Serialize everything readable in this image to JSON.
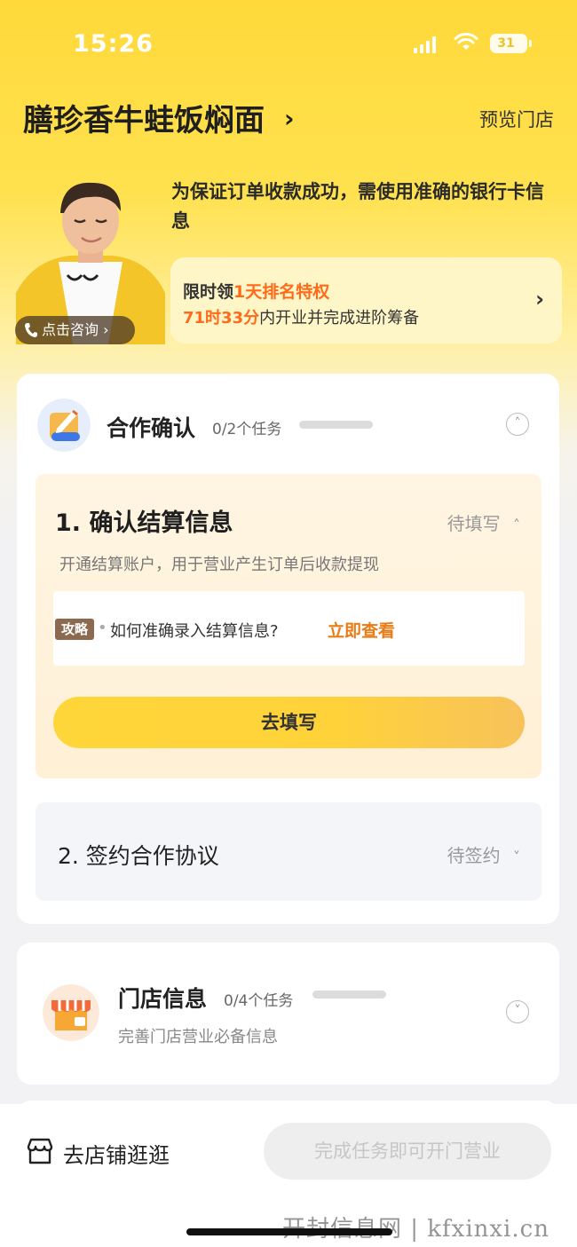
{
  "status_bar": {
    "time": "15:26",
    "battery": "31"
  },
  "header": {
    "store_name": "膳珍香牛蛙饭焖面",
    "chevron": "›",
    "preview_label": "预览门店"
  },
  "assistant": {
    "consult_label": "点击咨询 ›",
    "notice": "为保证订单收款成功，需使用准确的银行卡信息"
  },
  "promo": {
    "line1_prefix": "限时领",
    "line1_highlight": "1天排名特权",
    "line2_highlight": "71时33分",
    "line2_suffix": "内开业并完成进阶筹备",
    "chevron": "›"
  },
  "section_cooperation": {
    "title": "合作确认",
    "count": "0/2个任务",
    "toggle": "˄",
    "task1": {
      "title": "1. 确认结算信息",
      "status": "待填写",
      "status_arrow": "˄",
      "description": "开通结算账户，用于营业产生订单后收款提现",
      "tip_tag": "攻略",
      "tip_text": "如何准确录入结算信息?",
      "tip_link": "立即查看",
      "button": "去填写"
    },
    "task2": {
      "title": "2. 签约合作协议",
      "status": "待签约",
      "status_arrow": "˅"
    }
  },
  "section_store_info": {
    "title": "门店信息",
    "count": "0/4个任务",
    "subtitle": "完善门店营业必备信息",
    "toggle": "˅"
  },
  "bottom_bar": {
    "shop_label": "去店铺逛逛",
    "cta_label": "完成任务即可开门营业"
  },
  "watermark": "开封信息网 | kfxinxi.cn",
  "colors": {
    "brand_yellow": "#ffd93a",
    "highlight_orange": "#ff6a1a",
    "link_orange": "#e87b16"
  }
}
